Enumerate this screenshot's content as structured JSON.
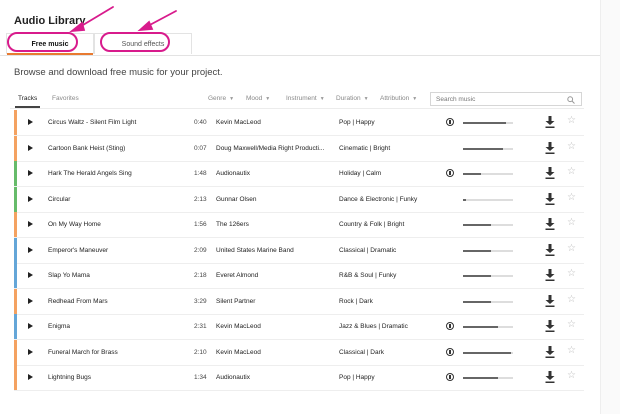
{
  "app": {
    "title": "Audio Library"
  },
  "tabs": [
    {
      "label": "Free music"
    },
    {
      "label": "Sound effects"
    }
  ],
  "subtitle": "Browse and download free music for your project.",
  "toolbar": {
    "tracks": "Tracks",
    "favorites": "Favorites",
    "genre": "Genre",
    "mood": "Mood",
    "instrument": "Instrument",
    "duration": "Duration",
    "attribution": "Attribution",
    "caret": "▼"
  },
  "search": {
    "placeholder": "Search music"
  },
  "icons": {
    "play": "play-icon",
    "download": "download-icon",
    "favorite": "star-icon",
    "attribution": "attribution-icon",
    "search": "search-icon"
  },
  "colors": {
    "tab_accent": "#e87a30",
    "annotation": "#d81b8c",
    "stripe_orange": "#f4a261",
    "stripe_green": "#66bb6a",
    "stripe_blue": "#64a6d8"
  },
  "tracks": [
    {
      "title": "Circus Waltz - Silent Film Light",
      "duration": "0:40",
      "artist": "Kevin MacLeod",
      "category": "Pop | Happy",
      "attribution": true,
      "popularity": 0.85,
      "stripe": "#f4a261"
    },
    {
      "title": "Cartoon Bank Heist (Sting)",
      "duration": "0:07",
      "artist": "Doug Maxwell/Media Right Producti...",
      "category": "Cinematic | Bright",
      "attribution": false,
      "popularity": 0.8,
      "stripe": "#f4a261"
    },
    {
      "title": "Hark The Herald Angels Sing",
      "duration": "1:48",
      "artist": "Audionautix",
      "category": "Holiday | Calm",
      "attribution": true,
      "popularity": 0.35,
      "stripe": "#66bb6a"
    },
    {
      "title": "Circular",
      "duration": "2:13",
      "artist": "Gunnar Olsen",
      "category": "Dance & Electronic | Funky",
      "attribution": false,
      "popularity": 0.05,
      "stripe": "#66bb6a"
    },
    {
      "title": "On My Way Home",
      "duration": "1:56",
      "artist": "The 126ers",
      "category": "Country & Folk | Bright",
      "attribution": false,
      "popularity": 0.55,
      "stripe": "#f4a261"
    },
    {
      "title": "Emperor's Maneuver",
      "duration": "2:09",
      "artist": "United States Marine Band",
      "category": "Classical | Dramatic",
      "attribution": false,
      "popularity": 0.55,
      "stripe": "#64a6d8"
    },
    {
      "title": "Slap Yo Mama",
      "duration": "2:18",
      "artist": "Everet Almond",
      "category": "R&B & Soul | Funky",
      "attribution": false,
      "popularity": 0.55,
      "stripe": "#64a6d8"
    },
    {
      "title": "Redhead From Mars",
      "duration": "3:29",
      "artist": "Silent Partner",
      "category": "Rock | Dark",
      "attribution": false,
      "popularity": 0.55,
      "stripe": "#f4a261"
    },
    {
      "title": "Enigma",
      "duration": "2:31",
      "artist": "Kevin MacLeod",
      "category": "Jazz & Blues | Dramatic",
      "attribution": true,
      "popularity": 0.7,
      "stripe": "#64a6d8"
    },
    {
      "title": "Funeral March for Brass",
      "duration": "2:10",
      "artist": "Kevin MacLeod",
      "category": "Classical | Dark",
      "attribution": true,
      "popularity": 0.95,
      "stripe": "#f4a261"
    },
    {
      "title": "Lightning Bugs",
      "duration": "1:34",
      "artist": "Audionautix",
      "category": "Pop | Happy",
      "attribution": true,
      "popularity": 0.7,
      "stripe": "#f4a261"
    }
  ]
}
